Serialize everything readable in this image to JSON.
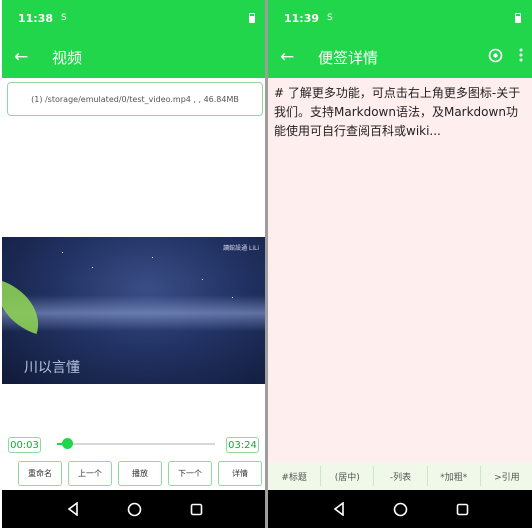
{
  "left": {
    "status": {
      "time": "11:38",
      "sim": "S"
    },
    "appbar": {
      "title": "视频"
    },
    "file_info": "(1) /storage/emulated/0/test_video.mp4 , , 46.84MB",
    "video": {
      "brand": "讀館設通 LiLi",
      "caption": "川以言懂"
    },
    "player": {
      "current_time": "00:03",
      "total_time": "03:24",
      "progress": 0.03
    },
    "controls": [
      "重命名",
      "上一个",
      "播放",
      "下一个",
      "详情"
    ]
  },
  "right": {
    "status": {
      "time": "11:39",
      "sim": "S"
    },
    "appbar": {
      "title": "便签详情"
    },
    "note": {
      "content": "# 了解更多功能，可点击右上角更多图标-关于我们。支持Markdown语法，及Markdown功能使用可自行查阅百科或wiki..."
    },
    "markdown_toolbar": [
      "#标题",
      "(居中)",
      "-列表",
      "*加粗*",
      ">引用"
    ]
  },
  "colors": {
    "accent": "#21d64b",
    "note_bg": "#ffeeee",
    "toolbar_bg": "#f0f9e9"
  },
  "icons": [
    "arrow-left-icon",
    "settings-circle-icon",
    "more-vert-icon",
    "battery-icon",
    "nav-back-icon",
    "nav-home-icon",
    "nav-recents-icon"
  ]
}
